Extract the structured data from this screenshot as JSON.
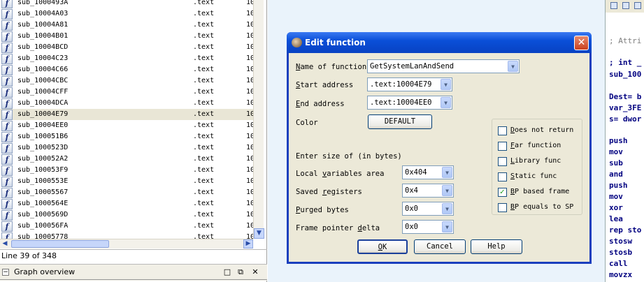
{
  "functions_window": {
    "rows": [
      {
        "name": "sub_1000493A",
        "segment": ".text",
        "start": "10"
      },
      {
        "name": "sub_10004A03",
        "segment": ".text",
        "start": "10"
      },
      {
        "name": "sub_10004A81",
        "segment": ".text",
        "start": "10"
      },
      {
        "name": "sub_10004B01",
        "segment": ".text",
        "start": "10"
      },
      {
        "name": "sub_10004BCD",
        "segment": ".text",
        "start": "10"
      },
      {
        "name": "sub_10004C23",
        "segment": ".text",
        "start": "10"
      },
      {
        "name": "sub_10004C66",
        "segment": ".text",
        "start": "10"
      },
      {
        "name": "sub_10004CBC",
        "segment": ".text",
        "start": "10"
      },
      {
        "name": "sub_10004CFF",
        "segment": ".text",
        "start": "10"
      },
      {
        "name": "sub_10004DCA",
        "segment": ".text",
        "start": "10"
      },
      {
        "name": "sub_10004E79",
        "segment": ".text",
        "start": "10"
      },
      {
        "name": "sub_10004EE0",
        "segment": ".text",
        "start": "10"
      },
      {
        "name": "sub_100051B6",
        "segment": ".text",
        "start": "10"
      },
      {
        "name": "sub_1000523D",
        "segment": ".text",
        "start": "10"
      },
      {
        "name": "sub_100052A2",
        "segment": ".text",
        "start": "10"
      },
      {
        "name": "sub_100053F9",
        "segment": ".text",
        "start": "10"
      },
      {
        "name": "sub_1000553E",
        "segment": ".text",
        "start": "10"
      },
      {
        "name": "sub_10005567",
        "segment": ".text",
        "start": "10"
      },
      {
        "name": "sub_1000564E",
        "segment": ".text",
        "start": "10"
      },
      {
        "name": "sub_1000569D",
        "segment": ".text",
        "start": "10"
      },
      {
        "name": "sub_100056FA",
        "segment": ".text",
        "start": "10"
      },
      {
        "name": "sub_10005778",
        "segment": ".text",
        "start": "10"
      }
    ],
    "selected_index": 10,
    "function_icon_glyph": "f",
    "status_line": "Line 39 of 348"
  },
  "graph_overview": {
    "title": "Graph overview",
    "toggle_glyph": "−",
    "restore_glyph": "□",
    "float_glyph": "⧉",
    "close_glyph": "✕"
  },
  "scroll_glyphs": {
    "down": "▼",
    "left": "◀",
    "right": "▶"
  },
  "disassembly": {
    "lines": [
      {
        "text": "; Attri",
        "kind": "comment"
      },
      {
        "text": "; int _",
        "kind": "code"
      },
      {
        "text": "sub_100",
        "kind": "code"
      },
      {
        "text": "Dest= b",
        "kind": "code"
      },
      {
        "text": "var_3FE",
        "kind": "code"
      },
      {
        "text": "s= dwor",
        "kind": "code"
      },
      {
        "text": "push",
        "kind": "code"
      },
      {
        "text": "mov",
        "kind": "code"
      },
      {
        "text": "sub",
        "kind": "code"
      },
      {
        "text": "and",
        "kind": "code"
      },
      {
        "text": "push",
        "kind": "code"
      },
      {
        "text": "mov",
        "kind": "code"
      },
      {
        "text": "xor",
        "kind": "code"
      },
      {
        "text": "lea",
        "kind": "code"
      },
      {
        "text": "rep sto",
        "kind": "code"
      },
      {
        "text": "stosw",
        "kind": "code"
      },
      {
        "text": "stosb",
        "kind": "code"
      },
      {
        "text": "call",
        "kind": "code"
      },
      {
        "text": "movzx",
        "kind": "code"
      }
    ]
  },
  "dialog": {
    "title": "Edit function",
    "close_glyph": "✕",
    "arrow_glyph": "▼",
    "name_label_pre": "N",
    "name_label_rest": "ame of function",
    "name_value": "GetSystemLanAndSend",
    "start_label_pre": "S",
    "start_label_rest": "tart address",
    "start_value": ".text:10004E79",
    "end_label_pre": "E",
    "end_label_rest": "nd address",
    "end_value": ".text:10004EE0",
    "color_label": "Color",
    "color_button": "DEFAULT",
    "size_header": "Enter size of (in bytes)",
    "local_label_pre": "Local ",
    "local_label_u": "v",
    "local_label_rest": "ariables area",
    "local_value": "0x404",
    "saved_label_pre": "Saved ",
    "saved_label_u": "r",
    "saved_label_rest": "egisters",
    "saved_value": "0x4",
    "purged_label_pre": "P",
    "purged_label_rest": "urged bytes",
    "purged_value": "0x0",
    "frame_label_pre": "Frame pointer ",
    "frame_label_u": "d",
    "frame_label_rest": "elta",
    "frame_value": "0x0",
    "options": [
      {
        "pre": "D",
        "rest": "oes not return",
        "checked": false
      },
      {
        "pre": "F",
        "rest": "ar function",
        "checked": false
      },
      {
        "pre": "L",
        "rest": "ibrary func",
        "checked": false
      },
      {
        "pre": "S",
        "rest": "tatic func",
        "checked": false
      },
      {
        "pre": "B",
        "rest": "P based frame",
        "checked": true
      },
      {
        "pre": "B",
        "rest": "P equals to SP",
        "checked": false
      }
    ],
    "check_glyph": "✓",
    "ok_pre": "O",
    "ok_rest": "K",
    "cancel_label": "Cancel",
    "help_label": "Help"
  }
}
